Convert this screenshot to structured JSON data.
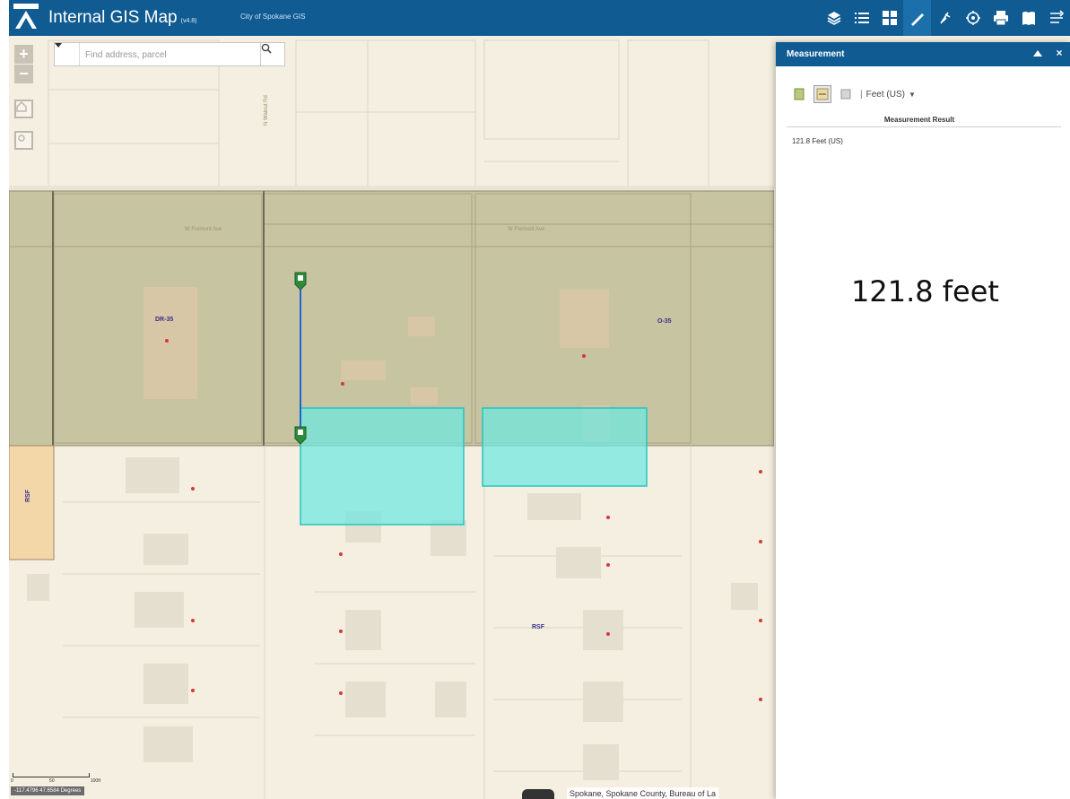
{
  "header": {
    "title": "Internal GIS Map",
    "title_suffix": "(v4.8)",
    "org": "City of Spokane GIS",
    "tools": [
      "layers-icon",
      "layer-list-icon",
      "basemap-gallery-icon",
      "measurement-icon",
      "draw-icon",
      "query-icon",
      "print-icon",
      "bookmark-icon",
      "swipe-icon"
    ]
  },
  "search": {
    "placeholder": "Find address, parcel"
  },
  "map": {
    "zone_labels": {
      "dr_left": "DR-35",
      "dr_right": "O-35",
      "rsf": "RSF",
      "side": "RSF"
    },
    "road_labels": {
      "upper_left": "W Fremont Ave",
      "upper_right": "W Fremont Ave",
      "vertical": "N Walnut Rd"
    },
    "measure_color": "#1e63d6",
    "highlight_color": "#6ee8e0",
    "zone_color": "#c7c4a1"
  },
  "scale": {
    "nums": [
      "0",
      "50",
      "100ft"
    ],
    "coords": "-117.4796 47.6584 Degrees"
  },
  "attribution": "Spokane, Spokane County, Bureau of La",
  "panel": {
    "title": "Measurement",
    "tools": [
      "area-icon",
      "distance-icon",
      "location-icon"
    ],
    "unit": "Feet (US)",
    "result_heading": "Measurement Result",
    "result_value": "121.8 Feet (US)"
  },
  "overlay_text": "121.8 feet"
}
